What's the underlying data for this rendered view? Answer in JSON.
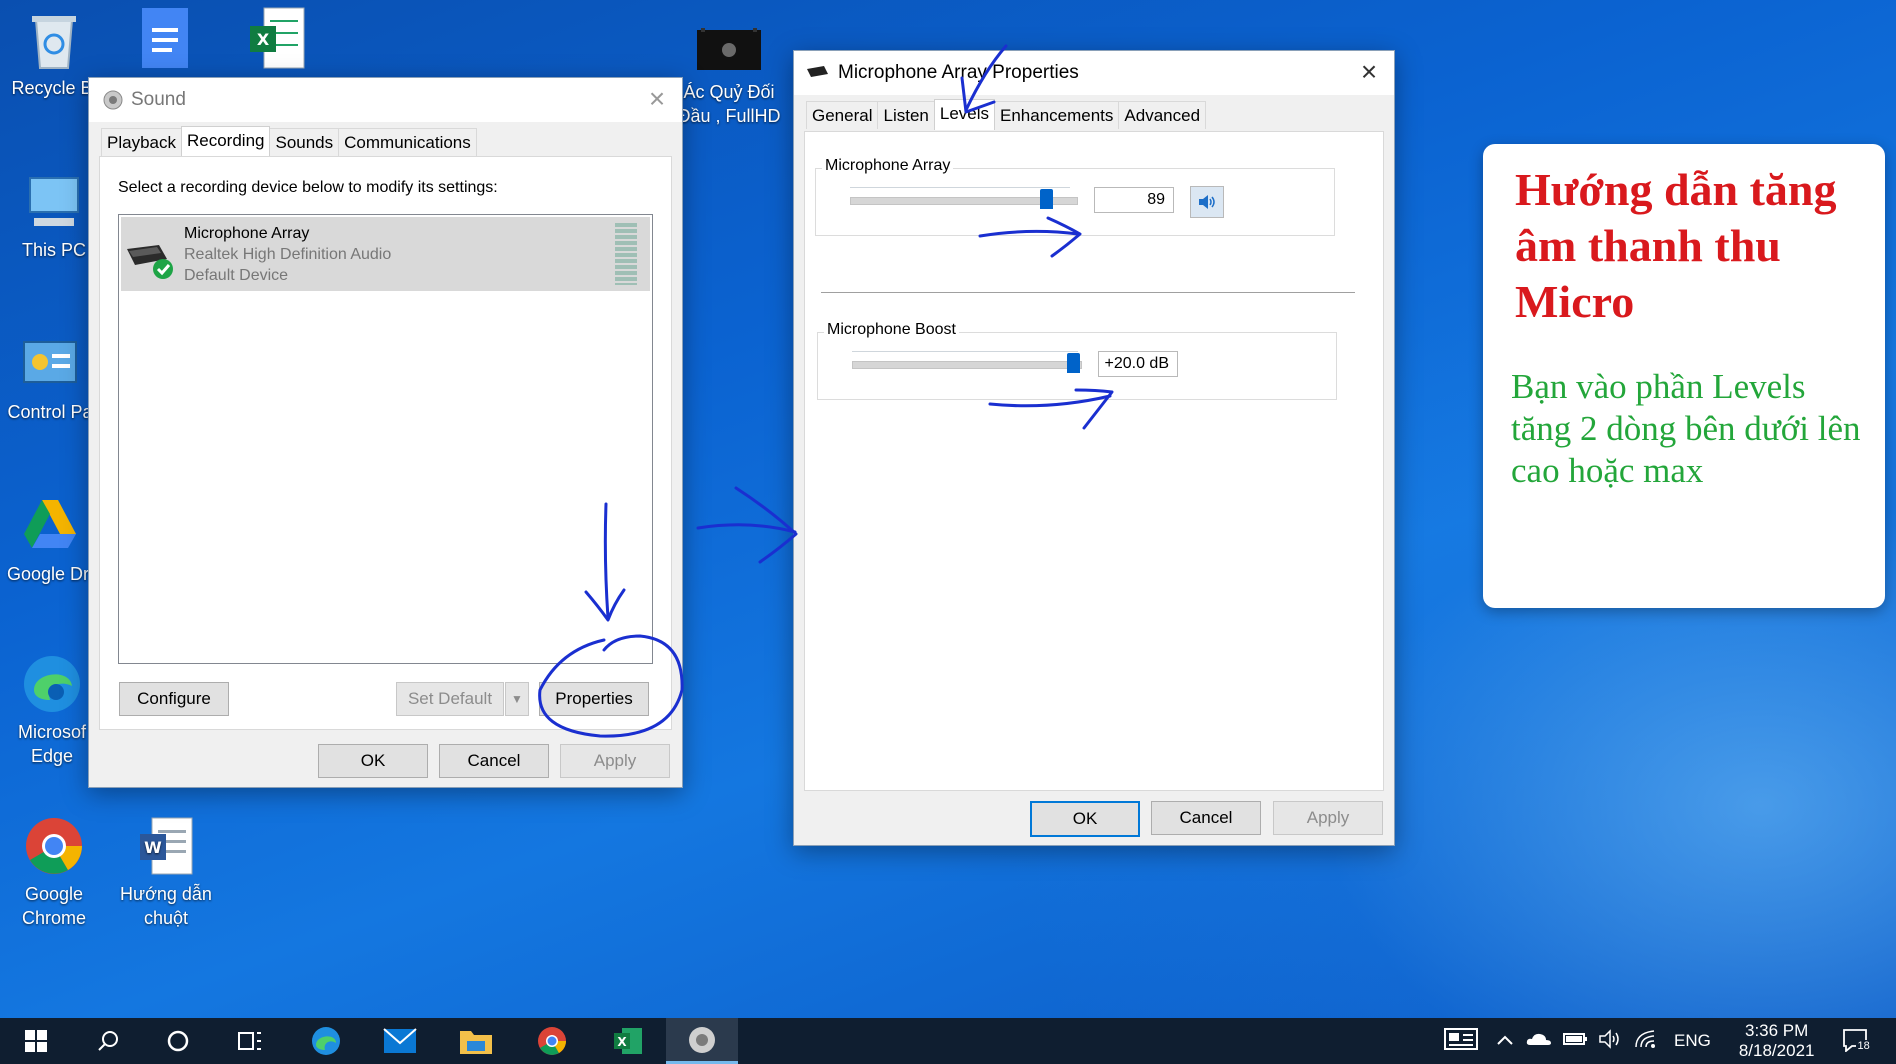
{
  "desktop": {
    "icons": [
      {
        "label": "Recycle Bi",
        "icon": "recycle-bin-icon"
      },
      {
        "label": "This PC",
        "icon": "this-pc-icon"
      },
      {
        "label": "Control Pa",
        "icon": "control-panel-icon"
      },
      {
        "label": "Google Dri",
        "icon": "google-drive-icon"
      },
      {
        "label": "Microsof\nEdge",
        "icon": "edge-icon"
      },
      {
        "label": "Google\nChrome",
        "icon": "chrome-icon"
      },
      {
        "label": "Hướng dẫn\nchuột",
        "icon": "word-doc-icon"
      },
      {
        "label": "Ác Quỷ Đối\nĐầu , FullHD",
        "icon": "video-file-icon"
      }
    ]
  },
  "sound_dialog": {
    "title": "Sound",
    "tabs": [
      "Playback",
      "Recording",
      "Sounds",
      "Communications"
    ],
    "active_tab": "Recording",
    "instruction": "Select a recording device below to modify its settings:",
    "device": {
      "name": "Microphone Array",
      "driver": "Realtek High Definition Audio",
      "status": "Default Device"
    },
    "buttons": {
      "configure": "Configure",
      "set_default": "Set Default",
      "properties": "Properties",
      "ok": "OK",
      "cancel": "Cancel",
      "apply": "Apply"
    }
  },
  "properties_dialog": {
    "title": "Microphone Array Properties",
    "tabs": [
      "General",
      "Listen",
      "Levels",
      "Enhancements",
      "Advanced"
    ],
    "active_tab": "Levels",
    "level_group": {
      "label": "Microphone Array",
      "value": "89",
      "level": 89
    },
    "boost_group": {
      "label": "Microphone Boost",
      "value": "+20.0 dB",
      "level": 100
    },
    "buttons": {
      "ok": "OK",
      "cancel": "Cancel",
      "apply": "Apply"
    }
  },
  "callout": {
    "heading": "Hướng dẫn tăng âm thanh thu Micro",
    "body": "Bạn vào phần Levels tăng 2 dòng bên dưới lên cao hoặc max"
  },
  "taskbar": {
    "language": "ENG",
    "time": "3:36 PM",
    "date": "8/18/2021",
    "notification_count": "18"
  },
  "colors": {
    "accent": "#0078d7",
    "callout_heading": "#d9191d",
    "callout_body": "#23a63a",
    "annotation_ink": "#1a2fd0"
  }
}
